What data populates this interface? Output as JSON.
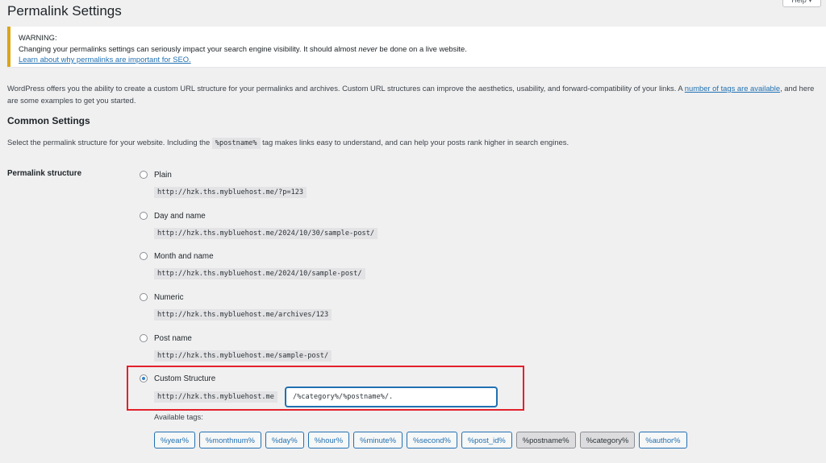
{
  "page": {
    "title": "Permalink Settings",
    "help_tab": "Help ▾"
  },
  "notice": {
    "heading": "WARNING:",
    "text_before": "Changing your permalinks settings can seriously impact your search engine visibility. It should almost ",
    "text_em": "never",
    "text_after": " be done on a live website.",
    "link": "Learn about why permalinks are important for SEO."
  },
  "intro": {
    "text_before": "WordPress offers you the ability to create a custom URL structure for your permalinks and archives. Custom URL structures can improve the aesthetics, usability, and forward-compatibility of your links. A ",
    "link": "number of tags are available",
    "text_after": ", and here are some examples to get you started."
  },
  "common": {
    "title": "Common Settings",
    "desc_before": "Select the permalink structure for your website. Including the ",
    "desc_code": "%postname%",
    "desc_after": " tag makes links easy to understand, and can help your posts rank higher in search engines."
  },
  "permalink": {
    "label": "Permalink structure",
    "options": [
      {
        "label": "Plain",
        "example": "http://hzk.ths.mybluehost.me/?p=123"
      },
      {
        "label": "Day and name",
        "example": "http://hzk.ths.mybluehost.me/2024/10/30/sample-post/"
      },
      {
        "label": "Month and name",
        "example": "http://hzk.ths.mybluehost.me/2024/10/sample-post/"
      },
      {
        "label": "Numeric",
        "example": "http://hzk.ths.mybluehost.me/archives/123"
      },
      {
        "label": "Post name",
        "example": "http://hzk.ths.mybluehost.me/sample-post/"
      }
    ],
    "custom": {
      "label": "Custom Structure",
      "base": "http://hzk.ths.mybluehost.me",
      "value": "/%category%/%postname%/."
    },
    "available_tags_label": "Available tags:",
    "tags": [
      "%year%",
      "%monthnum%",
      "%day%",
      "%hour%",
      "%minute%",
      "%second%",
      "%post_id%",
      "%postname%",
      "%category%",
      "%author%"
    ]
  },
  "colors": {
    "notice_border": "#dba617",
    "link": "#2271b1",
    "highlight": "#e3212b"
  }
}
